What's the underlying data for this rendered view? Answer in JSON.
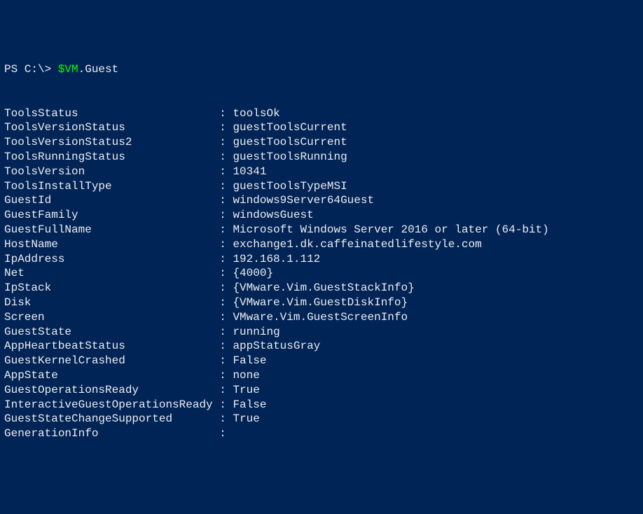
{
  "prompt": {
    "prefix": "PS C:\\> ",
    "variable": "$VM",
    "property": ".Guest"
  },
  "output": {
    "labelWidth": 32,
    "rows": [
      {
        "label": "ToolsStatus",
        "value": "toolsOk"
      },
      {
        "label": "ToolsVersionStatus",
        "value": "guestToolsCurrent"
      },
      {
        "label": "ToolsVersionStatus2",
        "value": "guestToolsCurrent"
      },
      {
        "label": "ToolsRunningStatus",
        "value": "guestToolsRunning"
      },
      {
        "label": "ToolsVersion",
        "value": "10341"
      },
      {
        "label": "ToolsInstallType",
        "value": "guestToolsTypeMSI"
      },
      {
        "label": "GuestId",
        "value": "windows9Server64Guest"
      },
      {
        "label": "GuestFamily",
        "value": "windowsGuest"
      },
      {
        "label": "GuestFullName",
        "value": "Microsoft Windows Server 2016 or later (64-bit)"
      },
      {
        "label": "HostName",
        "value": "exchange1.dk.caffeinatedlifestyle.com"
      },
      {
        "label": "IpAddress",
        "value": "192.168.1.112"
      },
      {
        "label": "Net",
        "value": "{4000}"
      },
      {
        "label": "IpStack",
        "value": "{VMware.Vim.GuestStackInfo}"
      },
      {
        "label": "Disk",
        "value": "{VMware.Vim.GuestDiskInfo}"
      },
      {
        "label": "Screen",
        "value": "VMware.Vim.GuestScreenInfo"
      },
      {
        "label": "GuestState",
        "value": "running"
      },
      {
        "label": "AppHeartbeatStatus",
        "value": "appStatusGray"
      },
      {
        "label": "GuestKernelCrashed",
        "value": "False"
      },
      {
        "label": "AppState",
        "value": "none"
      },
      {
        "label": "GuestOperationsReady",
        "value": "True"
      },
      {
        "label": "InteractiveGuestOperationsReady",
        "value": "False"
      },
      {
        "label": "GuestStateChangeSupported",
        "value": "True"
      },
      {
        "label": "GenerationInfo",
        "value": ""
      }
    ]
  }
}
